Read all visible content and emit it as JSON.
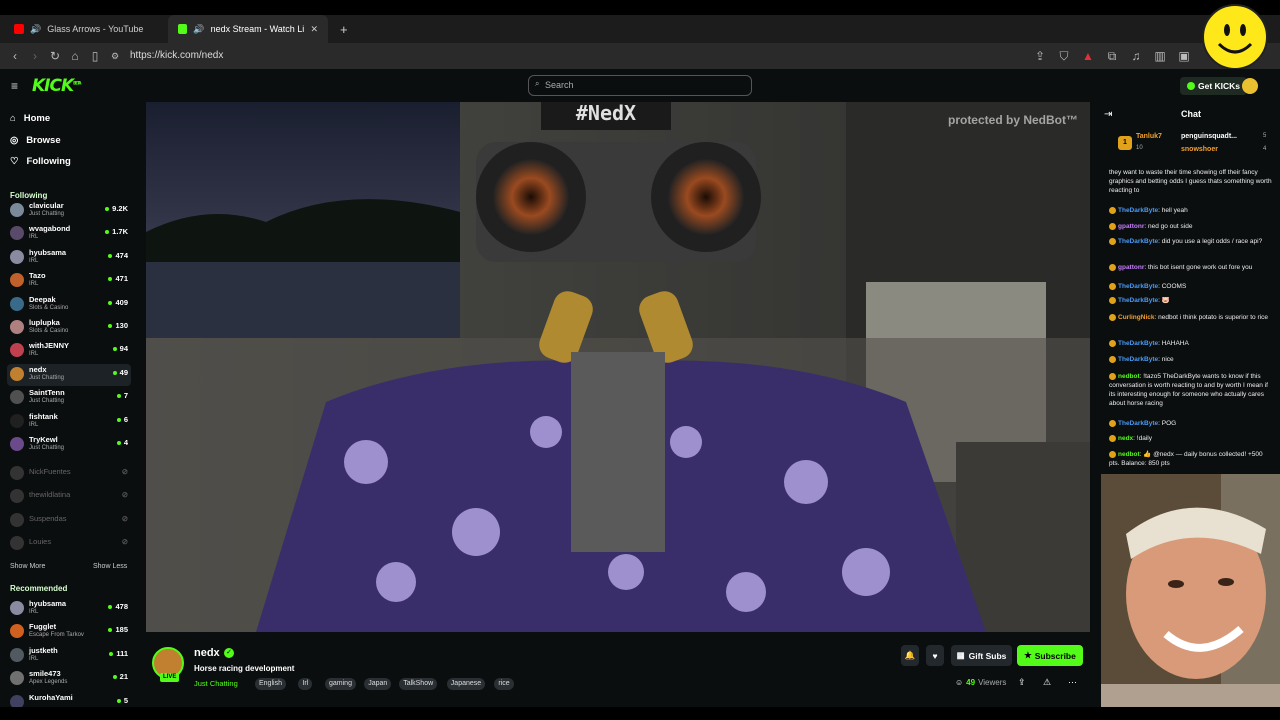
{
  "browser": {
    "tabs": [
      {
        "title": "Glass Arrows - YouTube"
      },
      {
        "title": "nedx Stream - Watch Live on"
      }
    ],
    "new_tab": "+",
    "url": "https://kick.com/nedx"
  },
  "kick": {
    "logo": "KICK",
    "logo_sup": "BETA",
    "search_placeholder": "Search",
    "get_kicks": "Get KICKs"
  },
  "sidebar": {
    "nav": [
      {
        "label": "Home",
        "icon": "home-icon"
      },
      {
        "label": "Browse",
        "icon": "compass-icon"
      },
      {
        "label": "Following",
        "icon": "heart-icon"
      }
    ],
    "following_title": "Following",
    "following": [
      {
        "name": "clavicular",
        "category": "Just Chatting",
        "viewers": "9.2K",
        "color": "#7a8a9a"
      },
      {
        "name": "wvagabond",
        "category": "IRL",
        "viewers": "1.7K",
        "color": "#5a4a6a"
      },
      {
        "name": "hyubsama",
        "category": "IRL",
        "viewers": "474",
        "color": "#8a8aa0"
      },
      {
        "name": "Tazo",
        "category": "IRL",
        "viewers": "471",
        "color": "#c0602a"
      },
      {
        "name": "Deepak",
        "category": "Slots & Casino",
        "viewers": "409",
        "color": "#3a6a8a"
      },
      {
        "name": "luplupka",
        "category": "Slots & Casino",
        "viewers": "130",
        "color": "#b08080"
      },
      {
        "name": "withJENNY",
        "category": "IRL",
        "viewers": "94",
        "color": "#c04050"
      },
      {
        "name": "nedx",
        "category": "Just Chatting",
        "viewers": "49",
        "color": "#c08030"
      },
      {
        "name": "SaintTenn",
        "category": "Just Chatting",
        "viewers": "7",
        "color": "#505050"
      },
      {
        "name": "fishtank",
        "category": "IRL",
        "viewers": "6",
        "color": "#202020"
      },
      {
        "name": "TryKewl",
        "category": "Just Chatting",
        "viewers": "4",
        "color": "#6a4a8a"
      }
    ],
    "offline": [
      "NickFuentes",
      "thewildlatina",
      "Suspendas",
      "Louies"
    ],
    "show_more": "Show More",
    "show_less": "Show Less",
    "recommended_title": "Recommended",
    "recommended": [
      {
        "name": "hyubsama",
        "category": "IRL",
        "viewers": "478",
        "color": "#8a8aa0"
      },
      {
        "name": "Fugglet",
        "category": "Escape From Tarkov",
        "viewers": "185",
        "color": "#d06020"
      },
      {
        "name": "justketh",
        "category": "IRL",
        "viewers": "111",
        "color": "#505a60"
      },
      {
        "name": "smile473",
        "category": "Apex Legends",
        "viewers": "21",
        "color": "#707070"
      },
      {
        "name": "KurohaYami",
        "category": "",
        "viewers": "5",
        "color": "#404060"
      }
    ]
  },
  "video": {
    "sign": "#NedX",
    "watermark": "protected by NedBot™"
  },
  "stream": {
    "streamer": "nedx",
    "live": "LIVE",
    "title": "Horse racing development",
    "category": "Just Chatting",
    "tags": [
      "English",
      "Irl",
      "gaming",
      "Japan",
      "TalkShow",
      "Japanese",
      "rice"
    ],
    "gift_subs": "Gift Subs",
    "subscribe": "Subscribe",
    "viewers": "49",
    "viewers_label": "Viewers"
  },
  "chat": {
    "title": "Chat",
    "gifters": [
      {
        "name": "Tanluk7",
        "count": "10"
      },
      {
        "name": "penguinsquadt...",
        "count": "5"
      },
      {
        "name": "snowshoer",
        "count": "4"
      }
    ],
    "messages": [
      {
        "user": "",
        "text": "they want to waste their time showing off their fancy graphics and betting odds I guess thats something worth reacting to",
        "color": "#53fc18"
      },
      {
        "user": "TheDarkByte",
        "text": "hell yeah",
        "color": "#4a9af5"
      },
      {
        "user": "gpattonr",
        "text": "ned go out side",
        "color": "#c77dff"
      },
      {
        "user": "TheDarkByte",
        "text": "did you use a legit odds / race api?",
        "color": "#4a9af5"
      },
      {
        "user": "gpattonr",
        "text": "this bot isent gone work out fore you",
        "color": "#c77dff"
      },
      {
        "user": "TheDarkByte",
        "text": "COOMS",
        "color": "#4a9af5"
      },
      {
        "user": "TheDarkByte",
        "text": "🐷",
        "color": "#4a9af5"
      },
      {
        "user": "CurlingNick",
        "text": "nedbot i think potato is superior to rice",
        "color": "#f0a030"
      },
      {
        "user": "TheDarkByte",
        "text": "HAHAHA",
        "color": "#4a9af5"
      },
      {
        "user": "TheDarkByte",
        "text": "nice",
        "color": "#4a9af5"
      },
      {
        "user": "nedbot",
        "text": "!tazo5 TheDarkByte wants to know if this conversation is worth reacting to and by worth I mean if its interesting enough for someone who actually cares about horse racing",
        "color": "#53fc18"
      },
      {
        "user": "TheDarkByte",
        "text": "POG",
        "color": "#4a9af5"
      },
      {
        "user": "nedx",
        "text": "!daily",
        "color": "#53fc18"
      },
      {
        "user": "nedbot",
        "text": "👍 @nedx — daily bonus collected! +500 pts. Balance: 850 pts",
        "color": "#53fc18"
      }
    ]
  }
}
